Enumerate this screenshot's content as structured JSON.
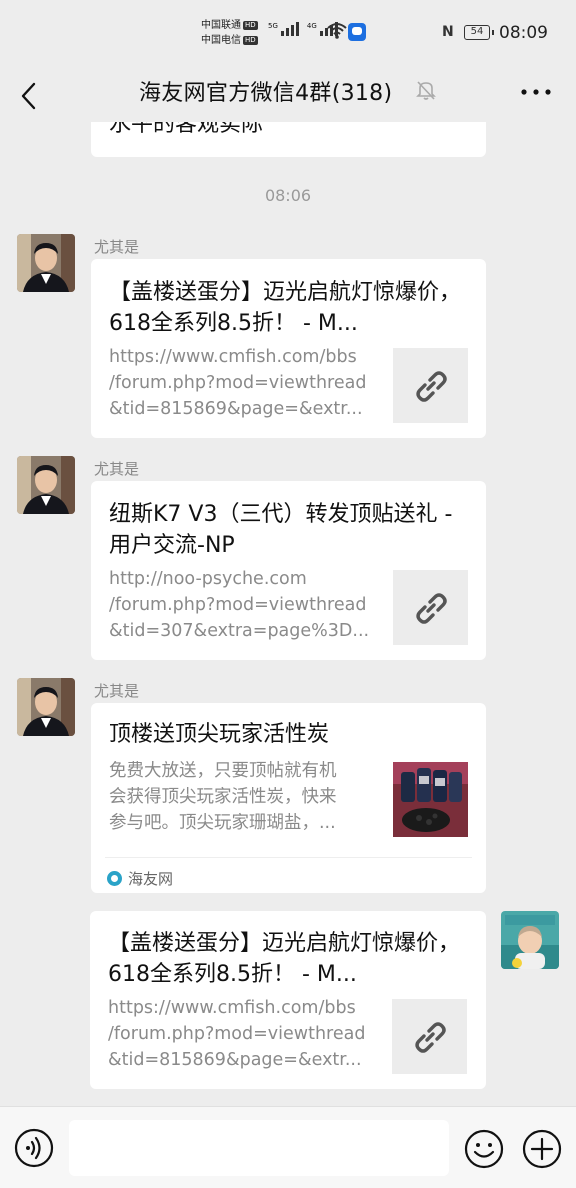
{
  "status_bar": {
    "carrier1": "中国联通",
    "carrier2": "中国电信",
    "hd_badge": "HD",
    "sig1_label": "5G",
    "sig2_label": "4G",
    "battery": "54",
    "nfc": "N",
    "time": "08:09"
  },
  "nav": {
    "title": "海友网官方微信4群(318)",
    "muted": true
  },
  "chat": {
    "partial_previous_text": "水平的客观实际",
    "time_separator": "08:06",
    "messages": [
      {
        "sender": "尤其是",
        "title": "【盖楼送蛋分】迈光启航灯惊爆价，618全系列8.5折！ - M...",
        "desc_lines": [
          "https://www.cmfish.com/bbs",
          "/forum.php?mod=viewthread",
          "&tid=815869&page=&extr..."
        ],
        "thumb": "link-icon"
      },
      {
        "sender": "尤其是",
        "title": "纽斯K7 V3（三代）转发顶贴送礼 - 用户交流-NP",
        "desc_lines": [
          "http://noo-psyche.com",
          "/forum.php?mod=viewthread",
          "&tid=307&extra=page%3D..."
        ],
        "thumb": "link-icon"
      },
      {
        "sender": "尤其是",
        "title": "顶楼送顶尖玩家活性炭",
        "desc_lines": [
          "免费大放送，只要顶帖就有机",
          "会获得顶尖玩家活性炭，快来",
          "参与吧。顶尖玩家珊瑚盐，..."
        ],
        "thumb": "product-photo",
        "source": "海友网"
      },
      {
        "sender": "",
        "title": "【盖楼送蛋分】迈光启航灯惊爆价，618全系列8.5折！ - M...",
        "desc_lines": [
          "https://www.cmfish.com/bbs",
          "/forum.php?mod=viewthread",
          "&tid=815869&page=&extr..."
        ],
        "thumb": "link-icon"
      }
    ]
  },
  "input_bar": {
    "placeholder": ""
  },
  "colors": {
    "background": "#ededed",
    "bubble": "#ffffff",
    "secondary_text": "#8a8a8a"
  }
}
